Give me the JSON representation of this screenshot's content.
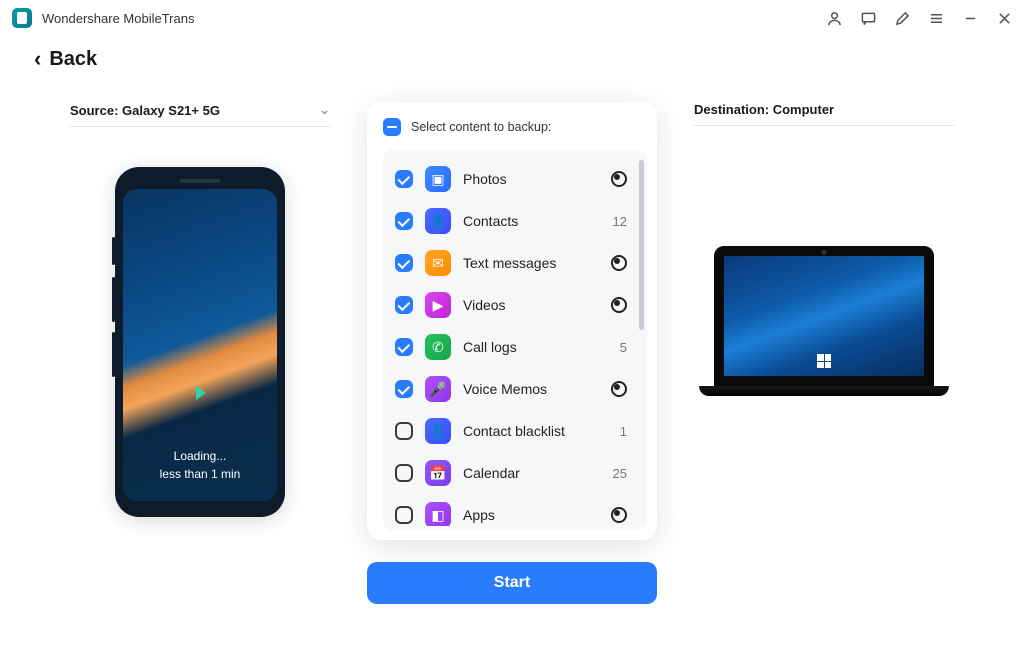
{
  "app": {
    "title": "Wondershare MobileTrans"
  },
  "back": {
    "label": "Back"
  },
  "source": {
    "label": "Source: Galaxy S21+ 5G"
  },
  "destination": {
    "label": "Destination: Computer"
  },
  "phone": {
    "loading_line1": "Loading...",
    "loading_line2": "less than 1 min"
  },
  "panel": {
    "title": "Select content to backup:"
  },
  "items": [
    {
      "label": "Photos",
      "checked": true,
      "iconClass": "ic-photos",
      "glyph": "▣",
      "count": null,
      "loading": true
    },
    {
      "label": "Contacts",
      "checked": true,
      "iconClass": "ic-contacts",
      "glyph": "👤",
      "count": "12",
      "loading": false
    },
    {
      "label": "Text messages",
      "checked": true,
      "iconClass": "ic-text",
      "glyph": "✉",
      "count": null,
      "loading": true
    },
    {
      "label": "Videos",
      "checked": true,
      "iconClass": "ic-videos",
      "glyph": "▶",
      "count": null,
      "loading": true
    },
    {
      "label": "Call logs",
      "checked": true,
      "iconClass": "ic-call",
      "glyph": "✆",
      "count": "5",
      "loading": false
    },
    {
      "label": "Voice Memos",
      "checked": true,
      "iconClass": "ic-voice",
      "glyph": "🎤",
      "count": null,
      "loading": true
    },
    {
      "label": "Contact blacklist",
      "checked": false,
      "iconClass": "ic-blacklist",
      "glyph": "👤",
      "count": "1",
      "loading": false
    },
    {
      "label": "Calendar",
      "checked": false,
      "iconClass": "ic-calendar",
      "glyph": "📅",
      "count": "25",
      "loading": false
    },
    {
      "label": "Apps",
      "checked": false,
      "iconClass": "ic-apps",
      "glyph": "◧",
      "count": null,
      "loading": true
    }
  ],
  "actions": {
    "start": "Start"
  }
}
